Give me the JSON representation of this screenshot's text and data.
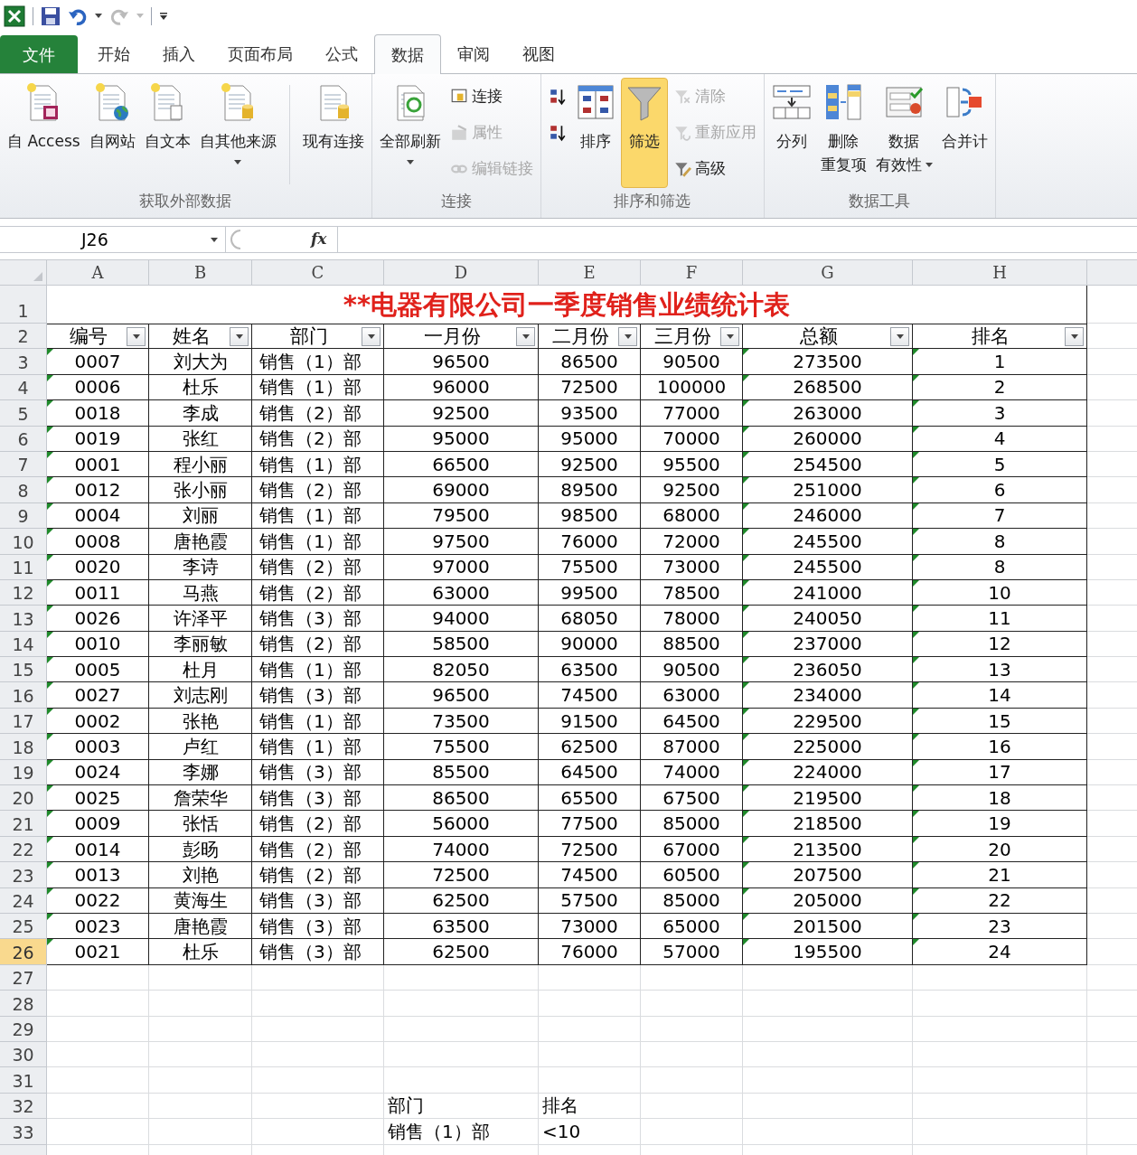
{
  "tabs": [
    {
      "label": "文件",
      "kind": "file",
      "selected": false
    },
    {
      "label": "开始",
      "kind": "tab",
      "selected": false
    },
    {
      "label": "插入",
      "kind": "tab",
      "selected": false
    },
    {
      "label": "页面布局",
      "kind": "tab",
      "selected": false
    },
    {
      "label": "公式",
      "kind": "tab",
      "selected": false
    },
    {
      "label": "数据",
      "kind": "tab",
      "selected": true
    },
    {
      "label": "审阅",
      "kind": "tab",
      "selected": false
    },
    {
      "label": "视图",
      "kind": "tab",
      "selected": false
    }
  ],
  "ribbon": [
    {
      "label": "获取外部数据",
      "items": [
        {
          "kind": "large",
          "lines": [
            "自 Access"
          ],
          "dropdown": false,
          "disabled": false,
          "on": false
        },
        {
          "kind": "large",
          "lines": [
            "自网站"
          ],
          "dropdown": false,
          "disabled": false,
          "on": false
        },
        {
          "kind": "large",
          "lines": [
            "自文本"
          ],
          "dropdown": false,
          "disabled": false,
          "on": false
        },
        {
          "kind": "large",
          "lines": [
            "自其他来源"
          ],
          "dropdown": true,
          "disabled": false,
          "on": false
        },
        {
          "kind": "separator"
        },
        {
          "kind": "large",
          "lines": [
            "现有连接"
          ],
          "dropdown": false,
          "disabled": false,
          "on": false
        }
      ]
    },
    {
      "label": "连接",
      "items": [
        {
          "kind": "large",
          "lines": [
            "全部刷新"
          ],
          "dropdown": true,
          "disabled": false,
          "on": false
        },
        {
          "kind": "stack",
          "items": [
            {
              "label": "连接",
              "disabled": false
            },
            {
              "label": "属性",
              "disabled": true
            },
            {
              "label": "编辑链接",
              "disabled": true
            }
          ]
        }
      ]
    },
    {
      "label": "排序和筛选",
      "items": [
        {
          "kind": "stack",
          "items": [
            {
              "disabled": false
            },
            {
              "disabled": false
            }
          ]
        },
        {
          "kind": "large",
          "lines": [
            "排序"
          ],
          "dropdown": false,
          "disabled": false,
          "on": false
        },
        {
          "kind": "large",
          "lines": [
            "筛选"
          ],
          "dropdown": false,
          "disabled": false,
          "on": true
        },
        {
          "kind": "stack",
          "items": [
            {
              "label": "清除",
              "disabled": true
            },
            {
              "label": "重新应用",
              "disabled": true
            },
            {
              "label": "高级",
              "disabled": false
            }
          ]
        }
      ]
    },
    {
      "label": "数据工具",
      "items": [
        {
          "kind": "large",
          "lines": [
            "分列"
          ],
          "dropdown": false,
          "disabled": false,
          "on": false
        },
        {
          "kind": "large",
          "lines": [
            "删除",
            "重复项"
          ],
          "dropdown": false,
          "disabled": false,
          "on": false
        },
        {
          "kind": "large",
          "lines": [
            "数据",
            "有效性"
          ],
          "dropdown": true,
          "disabled": false,
          "on": false
        },
        {
          "kind": "large",
          "lines": [
            "合并计"
          ],
          "dropdown": false,
          "disabled": false,
          "on": false
        }
      ]
    }
  ],
  "formula_bar": {
    "name_box": "J26",
    "function_label": "fx"
  },
  "columns": [
    {
      "letter": "A",
      "text_marker": true
    },
    {
      "letter": "B",
      "text_marker": false
    },
    {
      "letter": "C",
      "text_marker": false
    },
    {
      "letter": "D",
      "text_marker": false
    },
    {
      "letter": "E",
      "text_marker": false
    },
    {
      "letter": "F",
      "text_marker": false
    },
    {
      "letter": "G",
      "text_marker": true
    },
    {
      "letter": "H",
      "text_marker": true
    }
  ],
  "title_row": {
    "number": "1",
    "text": "**电器有限公司一季度销售业绩统计表"
  },
  "header_row": {
    "number": "2",
    "cells": [
      {
        "text": "编号",
        "filter": true
      },
      {
        "text": "姓名",
        "filter": true
      },
      {
        "text": "部门",
        "filter": true
      },
      {
        "text": "一月份",
        "filter": true
      },
      {
        "text": "二月份",
        "filter": true
      },
      {
        "text": "三月份",
        "filter": true
      },
      {
        "text": "总额",
        "filter": true
      },
      {
        "text": "排名",
        "filter": true
      }
    ]
  },
  "data_rows": [
    {
      "number": "3",
      "selected": false,
      "cells": [
        "0007",
        "刘大为",
        "销售（1）部",
        "96500",
        "86500",
        "90500",
        "273500",
        "1"
      ]
    },
    {
      "number": "4",
      "selected": false,
      "cells": [
        "0006",
        "杜乐",
        "销售（1）部",
        "96000",
        "72500",
        "100000",
        "268500",
        "2"
      ]
    },
    {
      "number": "5",
      "selected": false,
      "cells": [
        "0018",
        "李成",
        "销售（2）部",
        "92500",
        "93500",
        "77000",
        "263000",
        "3"
      ]
    },
    {
      "number": "6",
      "selected": false,
      "cells": [
        "0019",
        "张红",
        "销售（2）部",
        "95000",
        "95000",
        "70000",
        "260000",
        "4"
      ]
    },
    {
      "number": "7",
      "selected": false,
      "cells": [
        "0001",
        "程小丽",
        "销售（1）部",
        "66500",
        "92500",
        "95500",
        "254500",
        "5"
      ]
    },
    {
      "number": "8",
      "selected": false,
      "cells": [
        "0012",
        "张小丽",
        "销售（2）部",
        "69000",
        "89500",
        "92500",
        "251000",
        "6"
      ]
    },
    {
      "number": "9",
      "selected": false,
      "cells": [
        "0004",
        "刘丽",
        "销售（1）部",
        "79500",
        "98500",
        "68000",
        "246000",
        "7"
      ]
    },
    {
      "number": "10",
      "selected": false,
      "cells": [
        "0008",
        "唐艳霞",
        "销售（1）部",
        "97500",
        "76000",
        "72000",
        "245500",
        "8"
      ]
    },
    {
      "number": "11",
      "selected": false,
      "cells": [
        "0020",
        "李诗",
        "销售（2）部",
        "97000",
        "75500",
        "73000",
        "245500",
        "8"
      ]
    },
    {
      "number": "12",
      "selected": false,
      "cells": [
        "0011",
        "马燕",
        "销售（2）部",
        "63000",
        "99500",
        "78500",
        "241000",
        "10"
      ]
    },
    {
      "number": "13",
      "selected": false,
      "cells": [
        "0026",
        "许泽平",
        "销售（3）部",
        "94000",
        "68050",
        "78000",
        "240050",
        "11"
      ]
    },
    {
      "number": "14",
      "selected": false,
      "cells": [
        "0010",
        "李丽敏",
        "销售（2）部",
        "58500",
        "90000",
        "88500",
        "237000",
        "12"
      ]
    },
    {
      "number": "15",
      "selected": false,
      "cells": [
        "0005",
        "杜月",
        "销售（1）部",
        "82050",
        "63500",
        "90500",
        "236050",
        "13"
      ]
    },
    {
      "number": "16",
      "selected": false,
      "cells": [
        "0027",
        "刘志刚",
        "销售（3）部",
        "96500",
        "74500",
        "63000",
        "234000",
        "14"
      ]
    },
    {
      "number": "17",
      "selected": false,
      "cells": [
        "0002",
        "张艳",
        "销售（1）部",
        "73500",
        "91500",
        "64500",
        "229500",
        "15"
      ]
    },
    {
      "number": "18",
      "selected": false,
      "cells": [
        "0003",
        "卢红",
        "销售（1）部",
        "75500",
        "62500",
        "87000",
        "225000",
        "16"
      ]
    },
    {
      "number": "19",
      "selected": false,
      "cells": [
        "0024",
        "李娜",
        "销售（3）部",
        "85500",
        "64500",
        "74000",
        "224000",
        "17"
      ]
    },
    {
      "number": "20",
      "selected": false,
      "cells": [
        "0025",
        "詹荣华",
        "销售（3）部",
        "86500",
        "65500",
        "67500",
        "219500",
        "18"
      ]
    },
    {
      "number": "21",
      "selected": false,
      "cells": [
        "0009",
        "张恬",
        "销售（2）部",
        "56000",
        "77500",
        "85000",
        "218500",
        "19"
      ]
    },
    {
      "number": "22",
      "selected": false,
      "cells": [
        "0014",
        "彭旸",
        "销售（2）部",
        "74000",
        "72500",
        "67000",
        "213500",
        "20"
      ]
    },
    {
      "number": "23",
      "selected": false,
      "cells": [
        "0013",
        "刘艳",
        "销售（2）部",
        "72500",
        "74500",
        "60500",
        "207500",
        "21"
      ]
    },
    {
      "number": "24",
      "selected": false,
      "cells": [
        "0022",
        "黄海生",
        "销售（3）部",
        "62500",
        "57500",
        "85000",
        "205000",
        "22"
      ]
    },
    {
      "number": "25",
      "selected": false,
      "cells": [
        "0023",
        "唐艳霞",
        "销售（3）部",
        "63500",
        "73000",
        "65000",
        "201500",
        "23"
      ]
    },
    {
      "number": "26",
      "selected": true,
      "cells": [
        "0021",
        "杜乐",
        "销售（3）部",
        "62500",
        "76000",
        "57000",
        "195500",
        "24"
      ]
    }
  ],
  "other_rows": [
    {
      "number": "27"
    },
    {
      "number": "28"
    },
    {
      "number": "29"
    },
    {
      "number": "30"
    },
    {
      "number": "31"
    },
    {
      "number": "32",
      "cells": {
        "D": "部门",
        "E": "排名"
      }
    },
    {
      "number": "33",
      "cells": {
        "D": "销售（1）部",
        "E": "<10"
      }
    }
  ]
}
